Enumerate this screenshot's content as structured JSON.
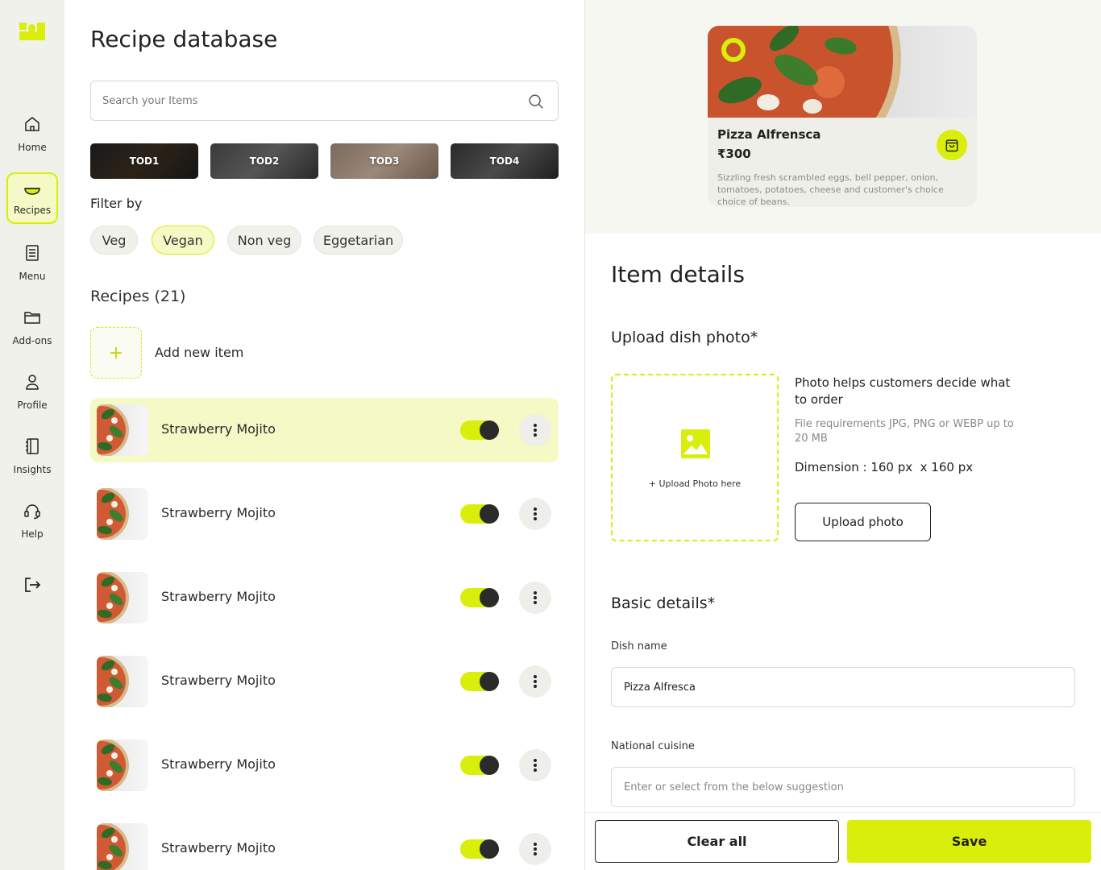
{
  "sidebar": {
    "items": [
      {
        "label": "Home",
        "icon": "home-icon"
      },
      {
        "label": "Recipes",
        "icon": "bowl-icon",
        "active": true
      },
      {
        "label": "Menu",
        "icon": "document-icon"
      },
      {
        "label": "Add-ons",
        "icon": "folder-icon"
      },
      {
        "label": "Profile",
        "icon": "user-icon"
      },
      {
        "label": "Insights",
        "icon": "notebook-icon"
      },
      {
        "label": "Help",
        "icon": "headset-icon"
      }
    ],
    "logout_icon": "logout-icon"
  },
  "main": {
    "title": "Recipe database",
    "search": {
      "placeholder": "Search your Items",
      "value": ""
    },
    "tods": [
      "TOD1",
      "TOD2",
      "TOD3",
      "TOD4"
    ],
    "filter_title": "Filter by",
    "filters": [
      {
        "label": "Veg",
        "active": false
      },
      {
        "label": "Vegan",
        "active": true
      },
      {
        "label": "Non veg",
        "active": false
      },
      {
        "label": "Eggetarian",
        "active": false
      }
    ],
    "recipes_title": "Recipes (21)",
    "add_new_label": "Add new item",
    "add_new_symbol": "+",
    "recipes": [
      {
        "name": "Strawberry Mojito",
        "enabled": true,
        "selected": true
      },
      {
        "name": "Strawberry Mojito",
        "enabled": true,
        "selected": false
      },
      {
        "name": "Strawberry Mojito",
        "enabled": true,
        "selected": false
      },
      {
        "name": "Strawberry Mojito",
        "enabled": true,
        "selected": false
      },
      {
        "name": "Strawberry Mojito",
        "enabled": true,
        "selected": false
      },
      {
        "name": "Strawberry Mojito",
        "enabled": true,
        "selected": false
      }
    ]
  },
  "preview": {
    "name": "Pizza Alfrensca",
    "price": "₹300",
    "description": "Sizzling fresh scrambled eggs, bell pepper, onion, tomatoes, potatoes, cheese and customer's choice choice of beans."
  },
  "details": {
    "title": "Item details",
    "upload_title": "Upload dish photo*",
    "upload_box_label": "+ Upload Photo here",
    "help_title": "Photo helps customers decide what to order",
    "help_requirements": "File requirements JPG, PNG or WEBP up to 20 MB",
    "help_dimension": "Dimension : 160 px  x 160 px",
    "upload_button": "Upload photo",
    "basic_title": "Basic details*",
    "dish_name_label": "Dish name",
    "dish_name_value": "Pizza Alfresca",
    "cuisine_label": "National cuisine",
    "cuisine_placeholder": "Enter or select from the below suggestion"
  },
  "footer": {
    "clear_label": "Clear all",
    "save_label": "Save"
  },
  "colors": {
    "accent": "#d9ee0a",
    "accent_light": "#f5f9c5",
    "sidebar_bg": "#f1f1ec",
    "text": "#222222"
  }
}
